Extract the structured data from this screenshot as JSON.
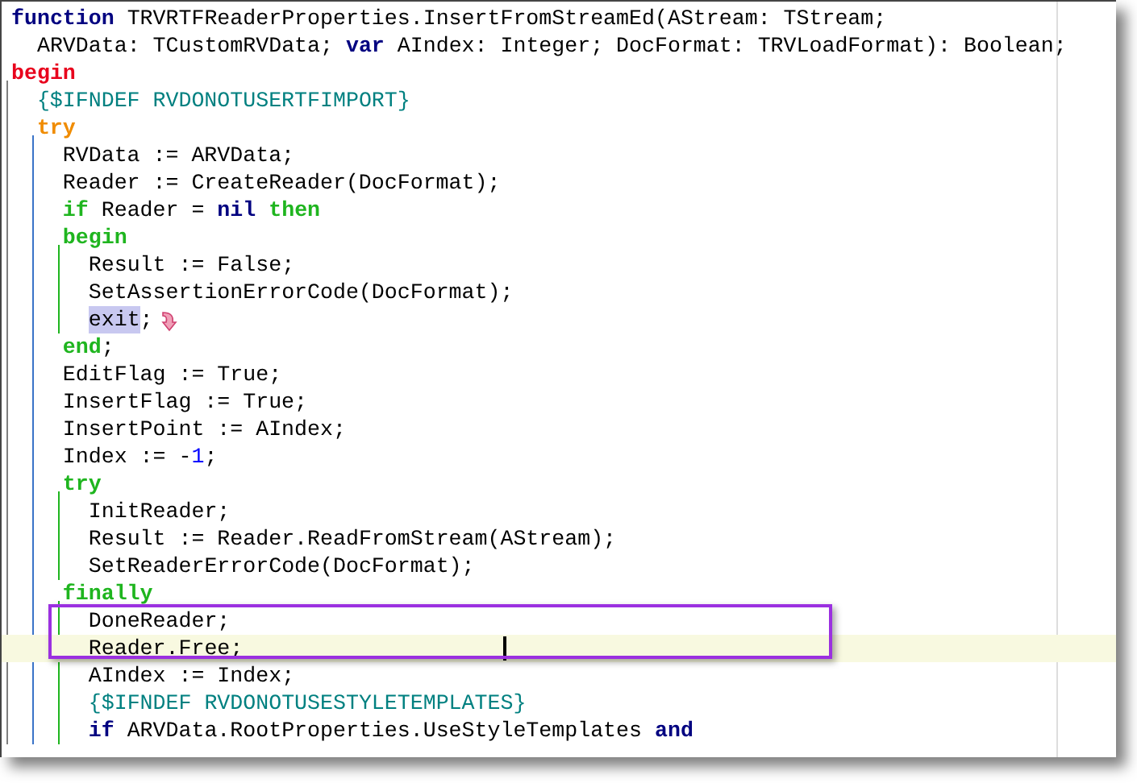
{
  "editor": {
    "lines": [
      {
        "tokens": [
          {
            "kind": "keyword",
            "text": "function"
          },
          {
            "kind": "plain",
            "text": " TRVRTFReaderProperties.InsertFromStreamEd(AStream: TStream;"
          }
        ]
      },
      {
        "tokens": [
          {
            "kind": "plain",
            "text": "  ARVData: TCustomRVData; "
          },
          {
            "kind": "keyword",
            "text": "var"
          },
          {
            "kind": "plain",
            "text": " AIndex: Integer; DocFormat: TRVLoadFormat): Boolean;"
          }
        ]
      },
      {
        "tokens": [
          {
            "kind": "block",
            "color": "#e8001c",
            "text": "begin"
          }
        ],
        "children": [
          {
            "tokens": [
              {
                "kind": "directive",
                "text": "{$IFNDEF RVDONOTUSERTFIMPORT}"
              }
            ]
          },
          {
            "tokens": [
              {
                "kind": "block",
                "color": "#f08c00",
                "text": "try"
              }
            ],
            "children": [
              {
                "tokens": [
                  {
                    "kind": "plain",
                    "text": "RVData := ARVData;"
                  }
                ]
              },
              {
                "tokens": [
                  {
                    "kind": "plain",
                    "text": "Reader := CreateReader(DocFormat);"
                  }
                ]
              },
              {
                "tokens": [
                  {
                    "kind": "block",
                    "color": "#1fb51f",
                    "text": "if"
                  },
                  {
                    "kind": "plain",
                    "text": " Reader = "
                  },
                  {
                    "kind": "keyword",
                    "text": "nil"
                  },
                  {
                    "kind": "block",
                    "color": "#1fb51f",
                    "text": " then"
                  }
                ]
              },
              {
                "tokens": [
                  {
                    "kind": "block",
                    "color": "#1fb51f",
                    "text": "begin"
                  }
                ],
                "children": [
                  {
                    "tokens": [
                      {
                        "kind": "plain",
                        "text": "Result := False;"
                      }
                    ]
                  },
                  {
                    "tokens": [
                      {
                        "kind": "plain",
                        "text": "SetAssertionErrorCode(DocFormat);"
                      }
                    ]
                  },
                  {
                    "tokens": [
                      {
                        "kind": "highlight",
                        "text": "exit"
                      },
                      {
                        "kind": "plain",
                        "text": ";"
                      }
                    ],
                    "jump": true
                  }
                ]
              },
              {
                "tokens": [
                  {
                    "kind": "block",
                    "color": "#1fb51f",
                    "text": "end"
                  },
                  {
                    "kind": "plain",
                    "text": ";"
                  }
                ]
              },
              {
                "tokens": [
                  {
                    "kind": "plain",
                    "text": "EditFlag := True;"
                  }
                ]
              },
              {
                "tokens": [
                  {
                    "kind": "plain",
                    "text": "InsertFlag := True;"
                  }
                ]
              },
              {
                "tokens": [
                  {
                    "kind": "plain",
                    "text": "InsertPoint := AIndex;"
                  }
                ]
              },
              {
                "tokens": [
                  {
                    "kind": "plain",
                    "text": "Index := -"
                  },
                  {
                    "kind": "number",
                    "text": "1"
                  },
                  {
                    "kind": "plain",
                    "text": ";"
                  }
                ]
              },
              {
                "tokens": [
                  {
                    "kind": "block",
                    "color": "#1fb51f",
                    "text": "try"
                  }
                ],
                "children": [
                  {
                    "tokens": [
                      {
                        "kind": "plain",
                        "text": "InitReader;"
                      }
                    ]
                  },
                  {
                    "tokens": [
                      {
                        "kind": "plain",
                        "text": "Result := Reader.ReadFromStream(AStream);"
                      }
                    ]
                  },
                  {
                    "tokens": [
                      {
                        "kind": "plain",
                        "text": "SetReaderErrorCode(DocFormat);"
                      }
                    ]
                  }
                ]
              },
              {
                "tokens": [
                  {
                    "kind": "block",
                    "color": "#1fb51f",
                    "text": "finally"
                  }
                ],
                "children": [
                  {
                    "tokens": [
                      {
                        "kind": "plain",
                        "text": "DoneReader;"
                      }
                    ],
                    "boxed": true
                  },
                  {
                    "tokens": [
                      {
                        "kind": "plain",
                        "text": "Reader.Free;"
                      }
                    ],
                    "boxed": true,
                    "current": true
                  },
                  {
                    "tokens": [
                      {
                        "kind": "plain",
                        "text": "AIndex := Index;"
                      }
                    ]
                  },
                  {
                    "tokens": [
                      {
                        "kind": "directive",
                        "text": "{$IFNDEF RVDONOTUSESTYLETEMPLATES}"
                      }
                    ]
                  },
                  {
                    "tokens": [
                      {
                        "kind": "keyword",
                        "text": "if"
                      },
                      {
                        "kind": "plain",
                        "text": " ARVData.RootProperties.UseStyleTemplates "
                      },
                      {
                        "kind": "keyword",
                        "text": "and"
                      }
                    ]
                  }
                ]
              }
            ]
          }
        ]
      }
    ]
  }
}
